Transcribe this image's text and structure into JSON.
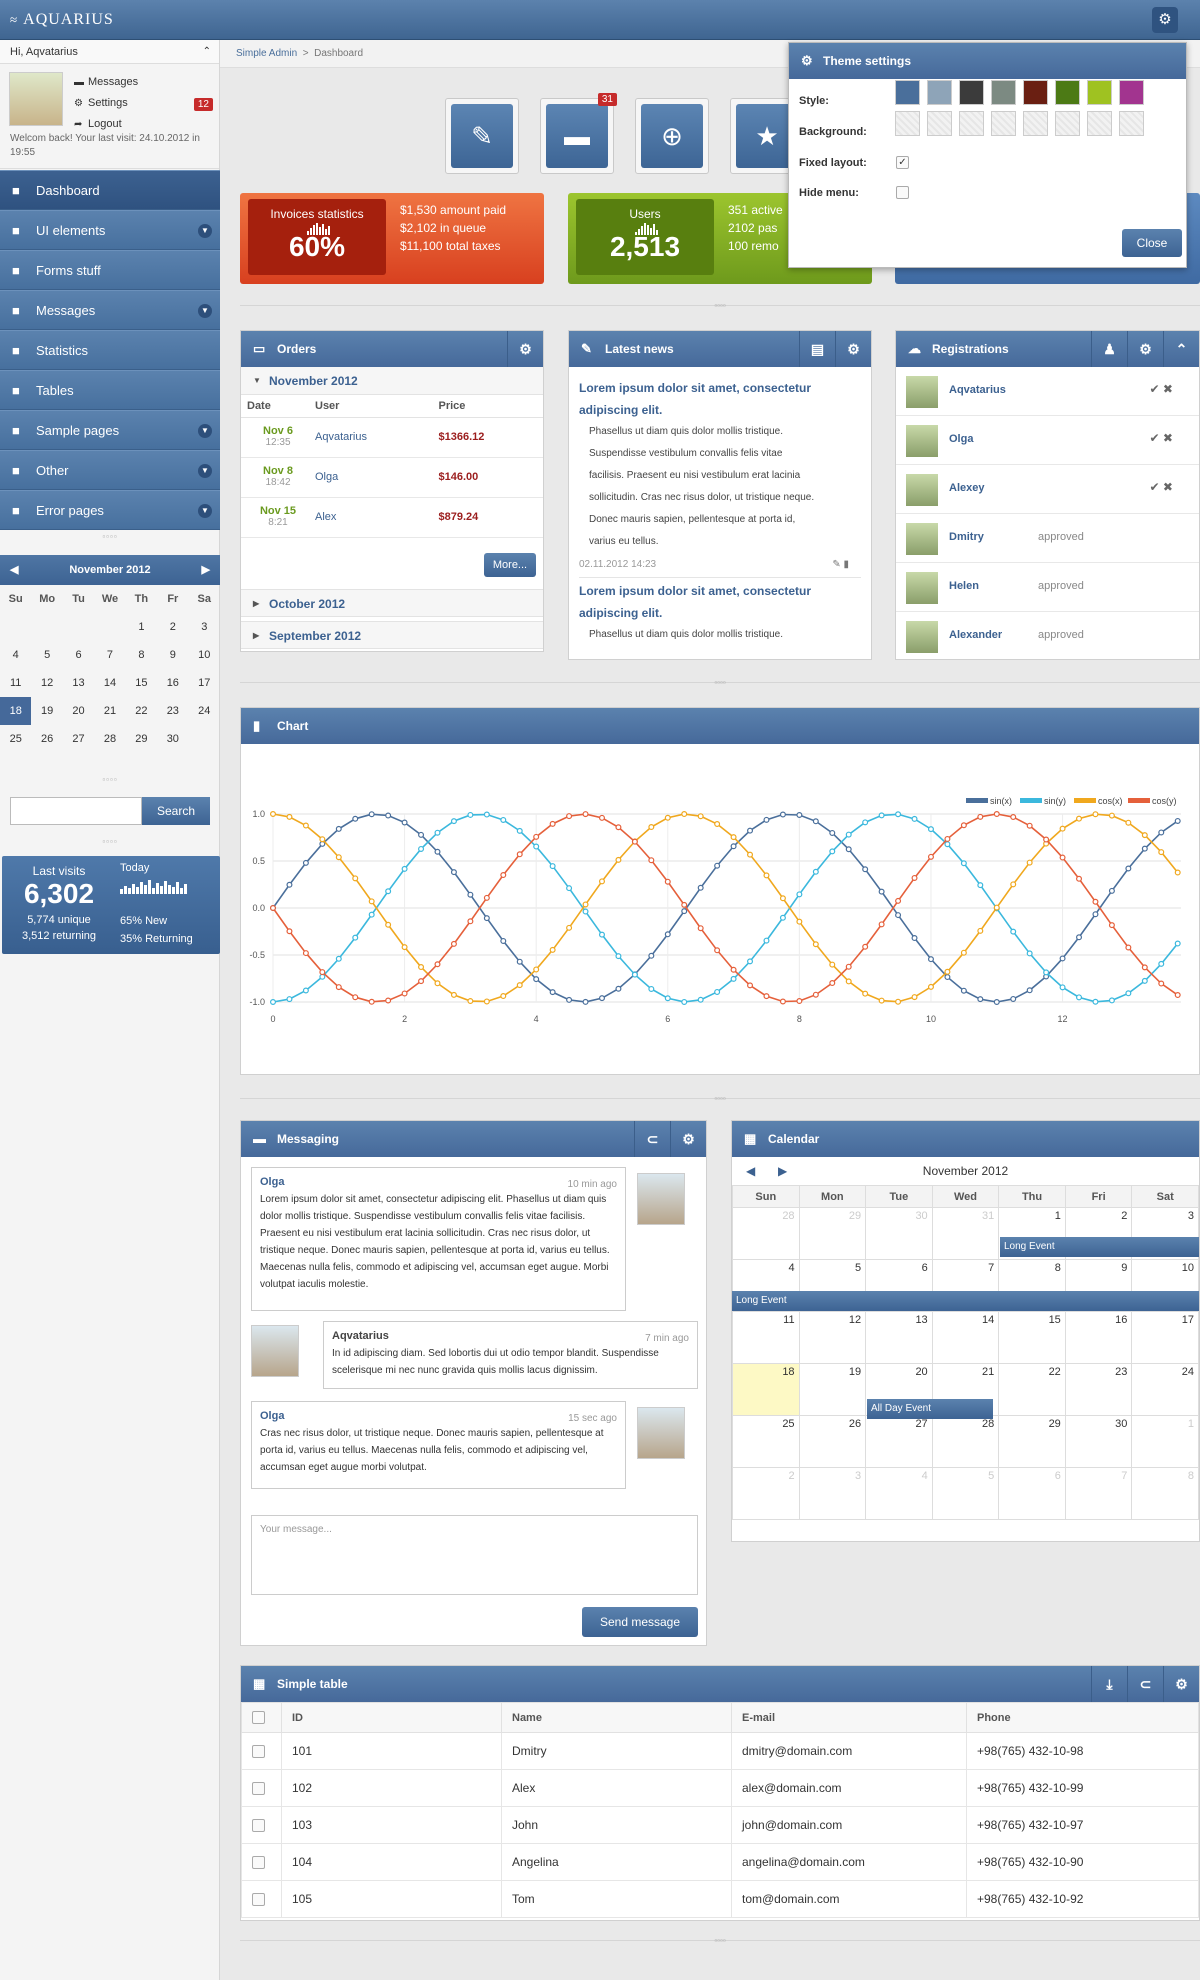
{
  "app": {
    "title": "AQUARIUS"
  },
  "sidebar": {
    "greeting": "Hi, Aqvatarius",
    "user_menu": [
      {
        "label": "Messages",
        "icon": "comment-icon"
      },
      {
        "label": "Settings",
        "icon": "gear-icon"
      },
      {
        "label": "Logout",
        "icon": "logout-icon"
      }
    ],
    "messages_badge": "12",
    "welcome": "Welcom back! Your last visit: 24.10.2012 in 19:55",
    "nav": [
      {
        "label": "Dashboard",
        "icon": "grid-icon",
        "active": true,
        "sub": false
      },
      {
        "label": "UI elements",
        "icon": "list-icon",
        "sub": true
      },
      {
        "label": "Forms stuff",
        "icon": "form-icon",
        "sub": false
      },
      {
        "label": "Messages",
        "icon": "comment-icon",
        "sub": true
      },
      {
        "label": "Statistics",
        "icon": "bar-chart-icon",
        "sub": false
      },
      {
        "label": "Tables",
        "icon": "document-icon",
        "sub": false
      },
      {
        "label": "Sample pages",
        "icon": "book-icon",
        "sub": true
      },
      {
        "label": "Other",
        "icon": "search-icon",
        "sub": true
      },
      {
        "label": "Error pages",
        "icon": "error-icon",
        "sub": true
      }
    ],
    "calendar": {
      "title": "November 2012",
      "days": [
        "Su",
        "Mo",
        "Tu",
        "We",
        "Th",
        "Fr",
        "Sa"
      ],
      "weeks": [
        [
          "",
          "",
          "",
          "",
          "1",
          "2",
          "3"
        ],
        [
          "4",
          "5",
          "6",
          "7",
          "8",
          "9",
          "10"
        ],
        [
          "11",
          "12",
          "13",
          "14",
          "15",
          "16",
          "17"
        ],
        [
          "18",
          "19",
          "20",
          "21",
          "22",
          "23",
          "24"
        ],
        [
          "25",
          "26",
          "27",
          "28",
          "29",
          "30",
          ""
        ]
      ],
      "today": "18"
    },
    "search": {
      "placeholder": "",
      "button": "Search"
    },
    "visits": {
      "label": "Last visits",
      "total": "6,302",
      "unique": "5,774 unique",
      "returning": "3,512 returning",
      "today_label": "Today",
      "new_pct": "65% New",
      "returning_pct": "35% Returning"
    }
  },
  "breadcrumb": [
    "Simple Admin",
    "Dashboard"
  ],
  "quick_buttons": [
    {
      "icon": "pencil-icon",
      "badge": ""
    },
    {
      "icon": "folder-icon",
      "badge": "31"
    },
    {
      "icon": "plus-circle-icon",
      "badge": ""
    },
    {
      "icon": "star-icon",
      "badge": ""
    }
  ],
  "stats": {
    "invoices": {
      "title": "Invoices statistics",
      "value": "60%",
      "lines": [
        "$1,530 amount paid",
        "$2,102 in queue",
        "$11,100 total taxes"
      ]
    },
    "users": {
      "title": "Users",
      "value": "2,513",
      "lines": [
        "351 active",
        "2102 pas",
        "100 remo"
      ]
    }
  },
  "orders": {
    "title": "Orders",
    "month": "November 2012",
    "columns": [
      "Date",
      "User",
      "Price"
    ],
    "rows": [
      {
        "date": "Nov 6",
        "time": "12:35",
        "user": "Aqvatarius",
        "price": "$1366.12"
      },
      {
        "date": "Nov 8",
        "time": "18:42",
        "user": "Olga",
        "price": "$146.00"
      },
      {
        "date": "Nov 15",
        "time": "8:21",
        "user": "Alex",
        "price": "$879.24"
      }
    ],
    "more": "More...",
    "other_months": [
      "October 2012",
      "September 2012"
    ]
  },
  "news": {
    "title": "Latest news",
    "items": [
      {
        "headline": "Lorem ipsum dolor sit amet, consectetur adipiscing elit.",
        "body": [
          "Phasellus ut diam quis dolor mollis tristique.",
          "Suspendisse vestibulum convallis felis vitae",
          "facilisis. Praesent eu nisi vestibulum erat lacinia",
          "sollicitudin. Cras nec risus dolor, ut tristique neque.",
          "Donec mauris sapien, pellentesque at porta id,",
          "varius eu tellus."
        ],
        "date": "02.11.2012 14:23"
      },
      {
        "headline": "Lorem ipsum dolor sit amet, consectetur adipiscing elit.",
        "body": [
          "Phasellus ut diam quis dolor mollis tristique."
        ],
        "date": ""
      }
    ]
  },
  "registrations": {
    "title": "Registrations",
    "users": [
      {
        "name": "Aqvatarius",
        "status": ""
      },
      {
        "name": "Olga",
        "status": ""
      },
      {
        "name": "Alexey",
        "status": ""
      },
      {
        "name": "Dmitry",
        "status": "approved"
      },
      {
        "name": "Helen",
        "status": "approved"
      },
      {
        "name": "Alexander",
        "status": "approved"
      }
    ]
  },
  "chart": {
    "title": "Chart"
  },
  "chart_data": {
    "type": "line",
    "title": "",
    "xlabel": "",
    "ylabel": "",
    "xlim": [
      0,
      13.8
    ],
    "ylim": [
      -1,
      1
    ],
    "xticks": [
      "0",
      "2",
      "4",
      "6",
      "8",
      "10",
      "12"
    ],
    "yticks": [
      "1.0",
      "0.5",
      "0.0",
      "-0.5",
      "-1.0"
    ],
    "legend_position": "top-right",
    "grid": true,
    "series": [
      {
        "name": "sin(x)",
        "color": "#4a6f9b"
      },
      {
        "name": "sin(y)",
        "color": "#3bb8dd"
      },
      {
        "name": "cos(x)",
        "color": "#f0a81e"
      },
      {
        "name": "cos(y)",
        "color": "#e5603b"
      }
    ]
  },
  "messaging": {
    "title": "Messaging",
    "messages": [
      {
        "name": "Olga",
        "time": "10 min ago",
        "text": "Lorem ipsum dolor sit amet, consectetur adipiscing elit. Phasellus ut diam quis dolor mollis tristique. Suspendisse vestibulum convallis felis vitae facilisis. Praesent eu nisi vestibulum erat lacinia sollicitudin. Cras nec risus dolor, ut tristique neque. Donec mauris sapien, pellentesque at porta id, varius eu tellus. Maecenas nulla felis, commodo et adipiscing vel, accumsan eget augue. Morbi volutpat iaculis molestie."
      },
      {
        "name": "Aqvatarius",
        "time": "7 min ago",
        "text": "In id adipiscing diam. Sed lobortis dui ut odio tempor blandit. Suspendisse scelerisque mi nec nunc gravida quis mollis lacus dignissim."
      },
      {
        "name": "Olga",
        "time": "15 sec ago",
        "text": "Cras nec risus dolor, ut tristique neque. Donec mauris sapien, pellentesque at porta id, varius eu tellus. Maecenas nulla felis, commodo et adipiscing vel, accumsan eget augue morbi volutpat."
      }
    ],
    "placeholder": "Your message...",
    "send": "Send message"
  },
  "calendar": {
    "title": "Calendar",
    "month": "November 2012",
    "days": [
      "Sun",
      "Mon",
      "Tue",
      "Wed",
      "Thu",
      "Fri",
      "Sat"
    ],
    "weeks": [
      [
        "28",
        "29",
        "30",
        "31",
        "1",
        "2",
        "3"
      ],
      [
        "4",
        "5",
        "6",
        "7",
        "8",
        "9",
        "10"
      ],
      [
        "11",
        "12",
        "13",
        "14",
        "15",
        "16",
        "17"
      ],
      [
        "18",
        "19",
        "20",
        "21",
        "22",
        "23",
        "24"
      ],
      [
        "25",
        "26",
        "27",
        "28",
        "29",
        "30",
        "1"
      ],
      [
        "2",
        "3",
        "4",
        "5",
        "6",
        "7",
        "8"
      ]
    ],
    "events": [
      "Long Event",
      "Long Event",
      "All Day Event"
    ]
  },
  "table": {
    "title": "Simple table",
    "columns": [
      "ID",
      "Name",
      "E-mail",
      "Phone"
    ],
    "rows": [
      [
        "101",
        "Dmitry",
        "dmitry@domain.com",
        "+98(765) 432-10-98"
      ],
      [
        "102",
        "Alex",
        "alex@domain.com",
        "+98(765) 432-10-99"
      ],
      [
        "103",
        "John",
        "john@domain.com",
        "+98(765) 432-10-97"
      ],
      [
        "104",
        "Angelina",
        "angelina@domain.com",
        "+98(765) 432-10-90"
      ],
      [
        "105",
        "Tom",
        "tom@domain.com",
        "+98(765) 432-10-92"
      ]
    ]
  },
  "theme": {
    "title": "Theme settings",
    "style_label": "Style:",
    "background_label": "Background:",
    "fixed_label": "Fixed layout:",
    "hide_label": "Hide menu:",
    "close": "Close",
    "styles": [
      "#4a6f9b",
      "#8ea4b8",
      "#3b3b3b",
      "#7c8a82",
      "#6a1f12",
      "#4c7a15",
      "#9fc221",
      "#a2348f"
    ]
  }
}
